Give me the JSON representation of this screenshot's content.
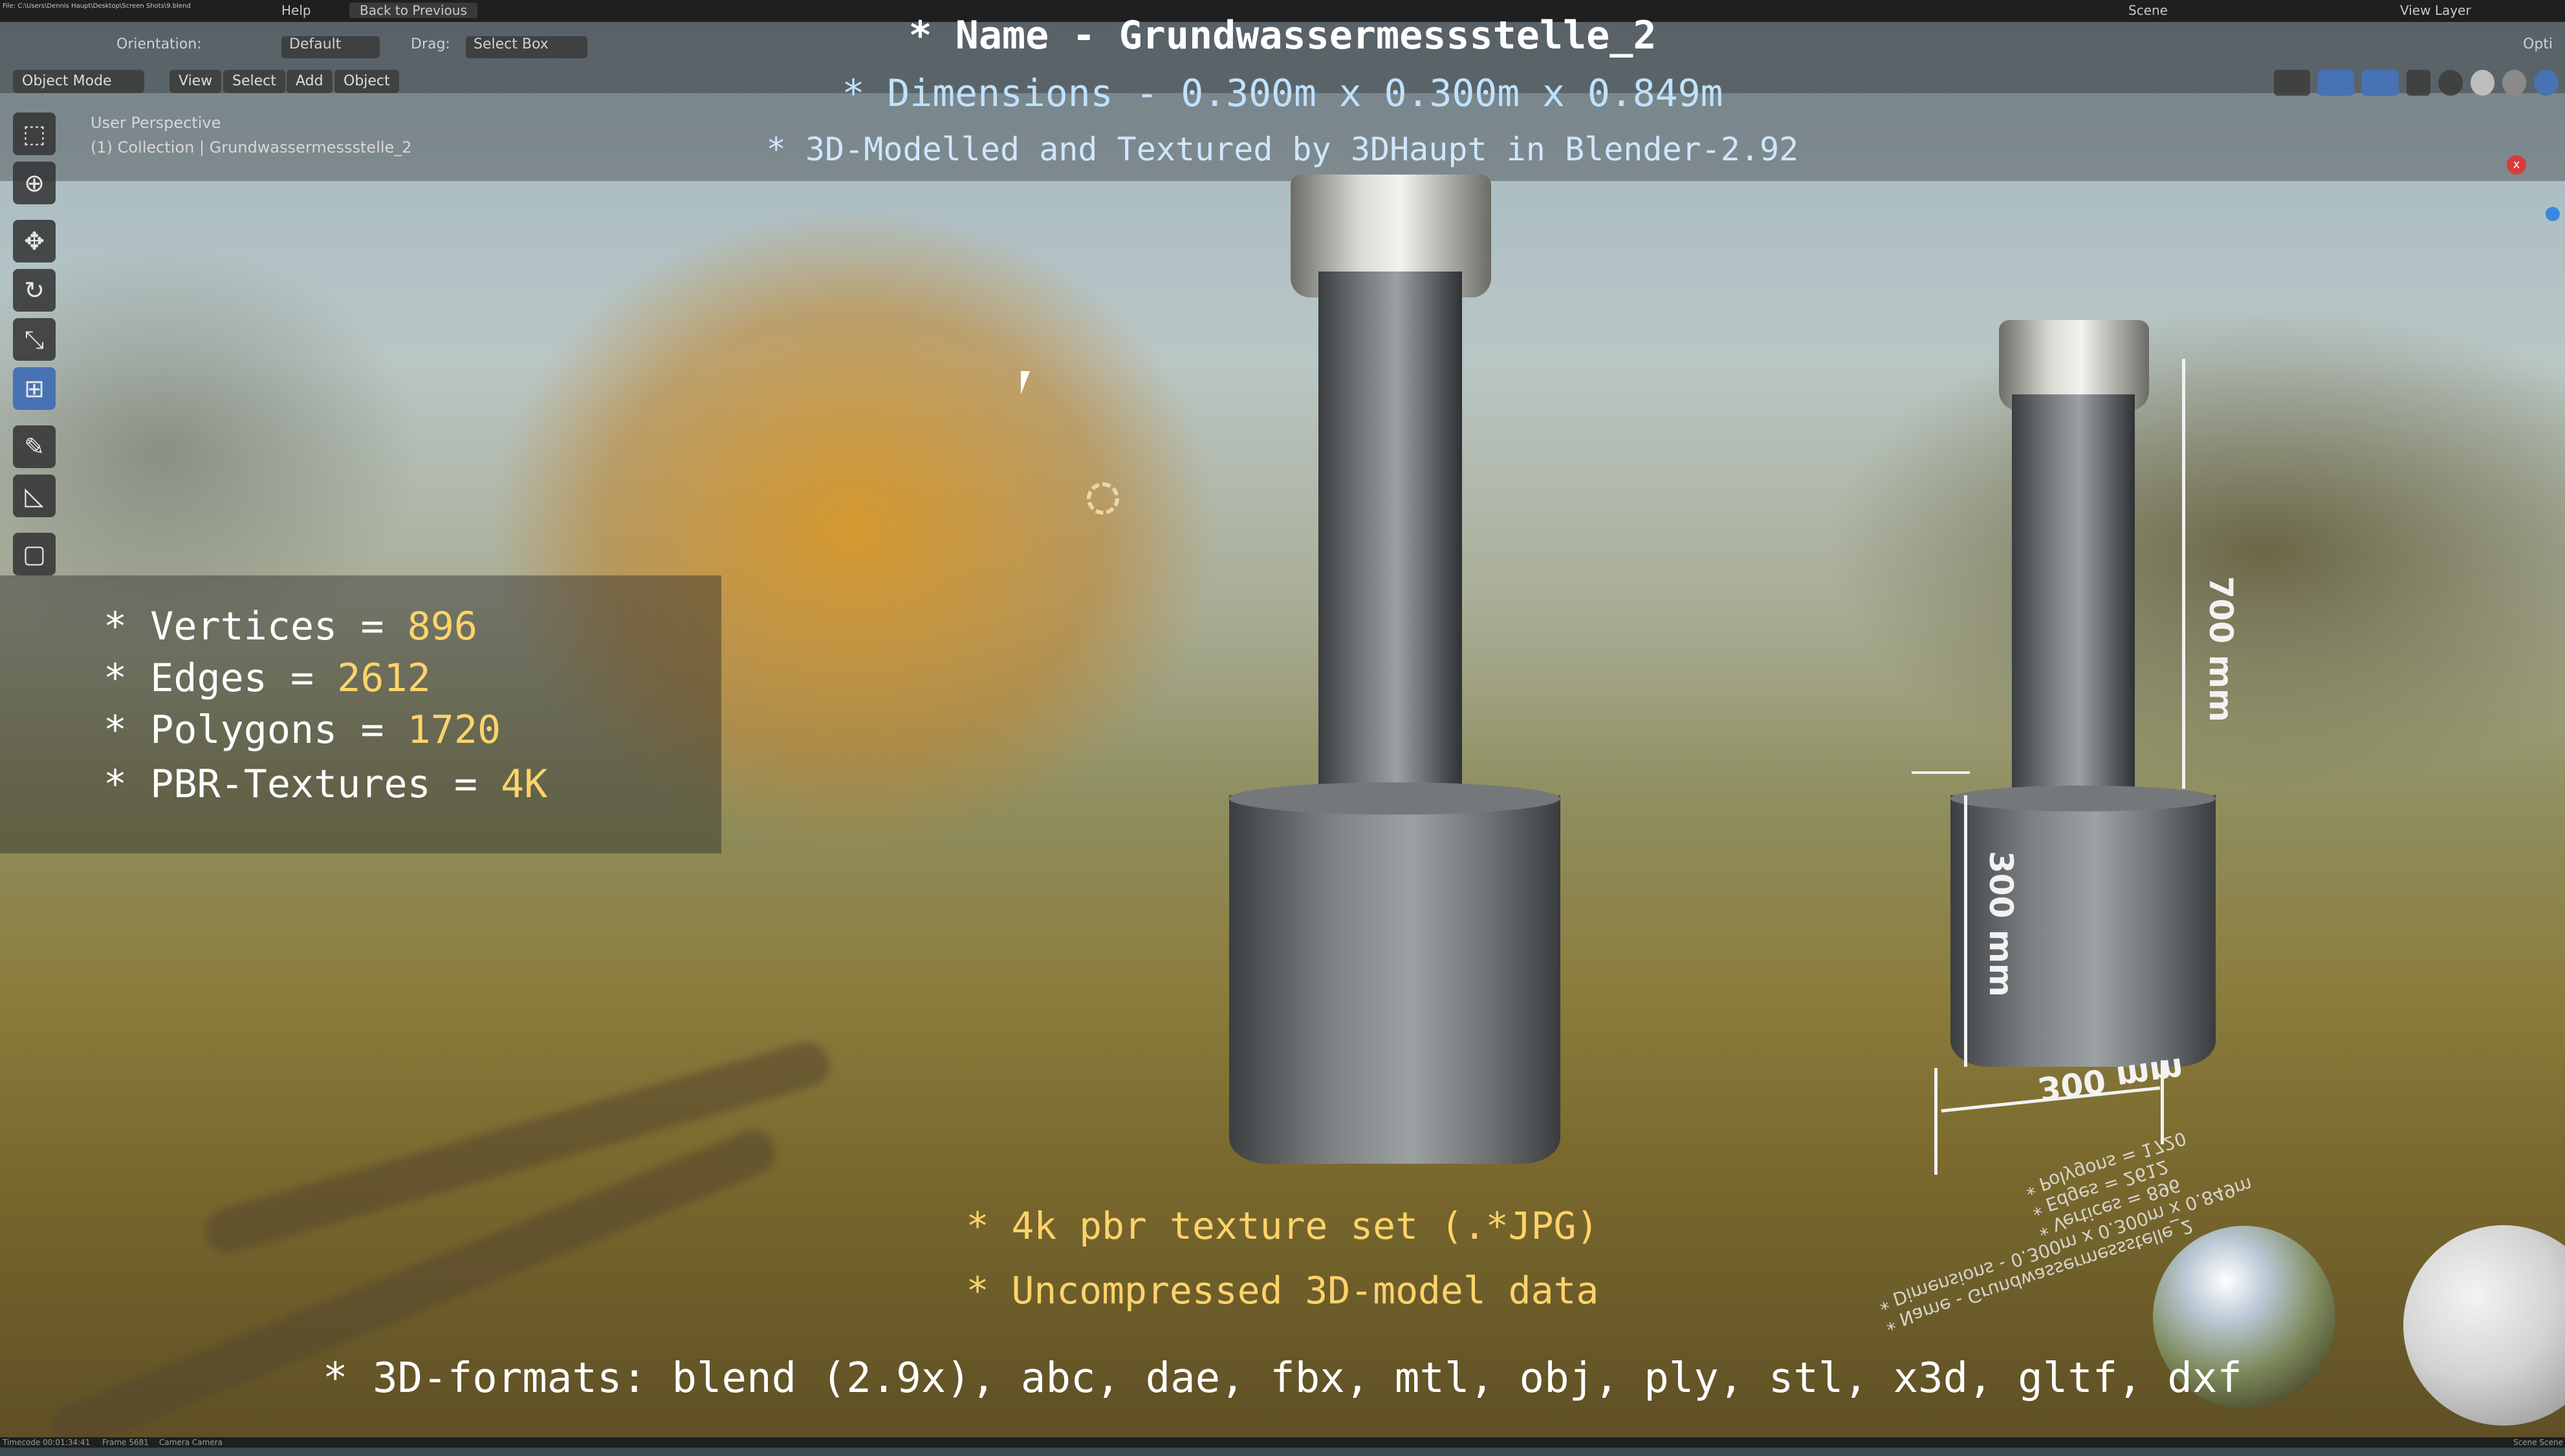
{
  "menu": {
    "file_info": "File: C:\\Users\\Dennis Haupt\\Desktop\\Screen Shots\\9.blend",
    "items": [
      "Help"
    ],
    "back_button": "Back to Previous",
    "scene": "Scene",
    "view_layer": "View Layer"
  },
  "header": {
    "orientation_label": "Orientation:",
    "orientation_value": "Default",
    "drag_label": "Drag:",
    "drag_value": "Select Box",
    "mode": "Object Mode",
    "menus": [
      "View",
      "Select",
      "Add",
      "Object"
    ],
    "options": "Opti"
  },
  "viewport": {
    "perspective": "User Perspective",
    "collection": "(1) Collection | Grundwassermessstelle_2"
  },
  "overlay": {
    "name": "* Name - Grundwassermessstelle_2",
    "dimensions": "* Dimensions -  0.300m x 0.300m x 0.849m",
    "credit": "* 3D-Modelled and Textured by 3DHaupt in Blender-2.92"
  },
  "stats": {
    "vertices_label": "* Vertices = ",
    "vertices": "896",
    "edges_label": "* Edges = ",
    "edges": "2612",
    "polygons_label": "* Polygons = ",
    "polygons": "1720",
    "textures_label": "* PBR-Textures = ",
    "textures": "4K"
  },
  "dimensions_drawn": {
    "height_upper": "700 mm",
    "height_lower": "300 mm",
    "width": "300 mm"
  },
  "mirror_text": {
    "line1": "* Name - Grundwassermessstelle_2",
    "line2": "* Dimensions - 0.300m x 0.300m x 0.849m",
    "line3": "* Vertices = 896",
    "line4": "* Edges = 2612",
    "line5": "* Polygons = 1720"
  },
  "bottom": {
    "line1": "* 4k pbr texture set (.*JPG)",
    "line2": "* Uncompressed 3D-model data",
    "formats": "* 3D-formats: blend (2.9x), abc, dae, fbx, mtl, obj, ply, stl, x3d, gltf, dxf"
  },
  "status": {
    "timecode": "Timecode 00:01:34:41",
    "frame": "Frame 5681",
    "camera": "Camera Camera",
    "scene_right": "Scene Scene"
  },
  "colors": {
    "accent": "#4772b3",
    "value_yellow": "#ffd36a",
    "title_blue": "#bfe2ff"
  }
}
